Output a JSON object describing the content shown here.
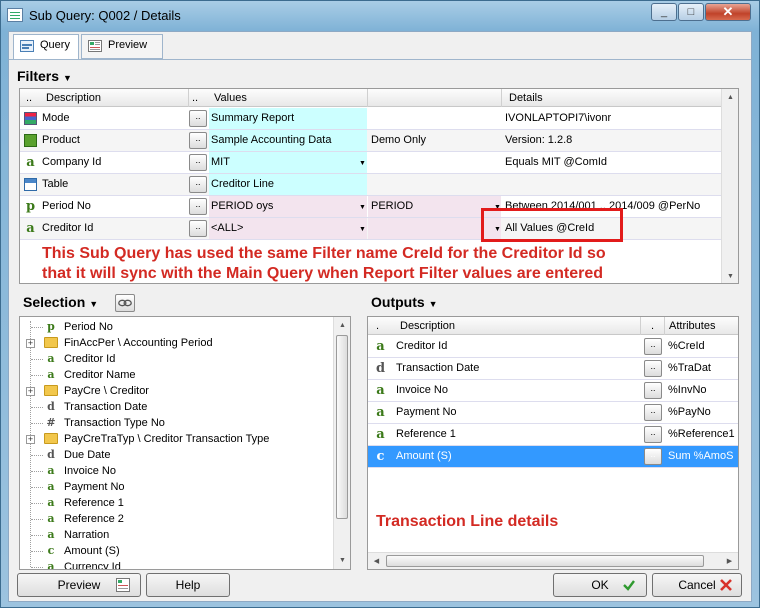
{
  "window": {
    "title": "Sub Query:  Q002 / Details",
    "min_label": "_",
    "max_label": "□",
    "close_label": "✕"
  },
  "tabs": [
    {
      "label": "Query"
    },
    {
      "label": "Preview"
    }
  ],
  "filters": {
    "label": "Filters",
    "columns": {
      "dots": "..",
      "description": "Description",
      "dots2": "..",
      "values": "Values",
      "details": "Details"
    },
    "rows": [
      {
        "icon": "mode-icon",
        "description": "Mode",
        "value": "Summary Report",
        "value2": "",
        "details": "IVONLAPTOPI7\\ivonr",
        "tint": "cyan"
      },
      {
        "icon": "product-icon",
        "description": "Product",
        "value": "Sample Accounting Data",
        "value2": "Demo Only",
        "details": "Version: 1.2.8",
        "tint": "cyan"
      },
      {
        "icon": "a",
        "description": "Company Id",
        "value": "MIT",
        "value2": "",
        "details": "Equals MIT @ComId",
        "tint": "cyan"
      },
      {
        "icon": "table-icon",
        "description": "Table",
        "value": "Creditor Line",
        "value2": "",
        "details": "",
        "tint": "cyan"
      },
      {
        "icon": "p",
        "description": "Period No",
        "value": "PERIOD oys",
        "value2": "PERIOD",
        "details": "Between 2014/001 .. 2014/009 @PerNo",
        "tint": "pink"
      },
      {
        "icon": "a",
        "description": "Creditor Id",
        "value": "<ALL>",
        "value2": "",
        "details": "All Values @CreId",
        "tint": "pink"
      }
    ],
    "dot_label": "..",
    "annotation_line1": "This Sub Query has used the same Filter name CreId for the Creditor Id so",
    "annotation_line2": "that it will sync with the Main Query when Report Filter values are entered"
  },
  "selection": {
    "label": "Selection",
    "items": [
      {
        "icon": "p",
        "text": "Period No",
        "folder": false
      },
      {
        "icon": "folder",
        "text": "FinAccPer \\ Accounting Period",
        "folder": true
      },
      {
        "icon": "a",
        "text": "Creditor Id",
        "folder": false
      },
      {
        "icon": "a",
        "text": "Creditor Name",
        "folder": false
      },
      {
        "icon": "folder",
        "text": "PayCre \\ Creditor",
        "folder": true
      },
      {
        "icon": "d",
        "text": "Transaction Date",
        "folder": false
      },
      {
        "icon": "#",
        "text": "Transaction Type No",
        "folder": false
      },
      {
        "icon": "folder",
        "text": "PayCreTraTyp \\ Creditor Transaction Type",
        "folder": true
      },
      {
        "icon": "d",
        "text": "Due Date",
        "folder": false
      },
      {
        "icon": "a",
        "text": "Invoice No",
        "folder": false
      },
      {
        "icon": "a",
        "text": "Payment No",
        "folder": false
      },
      {
        "icon": "a",
        "text": "Reference 1",
        "folder": false
      },
      {
        "icon": "a",
        "text": "Reference 2",
        "folder": false
      },
      {
        "icon": "a",
        "text": "Narration",
        "folder": false
      },
      {
        "icon": "c",
        "text": "Amount (S)",
        "folder": false
      },
      {
        "icon": "a",
        "text": "Currency Id",
        "folder": false
      }
    ]
  },
  "outputs": {
    "label": "Outputs",
    "columns": {
      "dot": ".",
      "description": "Description",
      "dot2": ".",
      "attributes": "Attributes"
    },
    "rows": [
      {
        "icon": "a",
        "description": "Creditor Id",
        "attributes": "%CreId",
        "selected": false
      },
      {
        "icon": "d",
        "description": "Transaction Date",
        "attributes": "%TraDat",
        "selected": false
      },
      {
        "icon": "a",
        "description": "Invoice No",
        "attributes": "%InvNo",
        "selected": false
      },
      {
        "icon": "a",
        "description": "Payment No",
        "attributes": "%PayNo",
        "selected": false
      },
      {
        "icon": "a",
        "description": "Reference 1",
        "attributes": "%Reference1",
        "selected": false
      },
      {
        "icon": "c",
        "description": "Amount (S)",
        "attributes": "Sum %AmoS",
        "selected": true
      }
    ],
    "annotation": "Transaction Line details"
  },
  "buttons": {
    "preview": "Preview",
    "help": "Help",
    "ok": "OK",
    "cancel": "Cancel"
  },
  "colors": {
    "annotation_red": "#d32a23",
    "cyan_tint": "#ccffff",
    "pink_tint": "#f3e4ee",
    "selected_row": "#3399ff"
  }
}
